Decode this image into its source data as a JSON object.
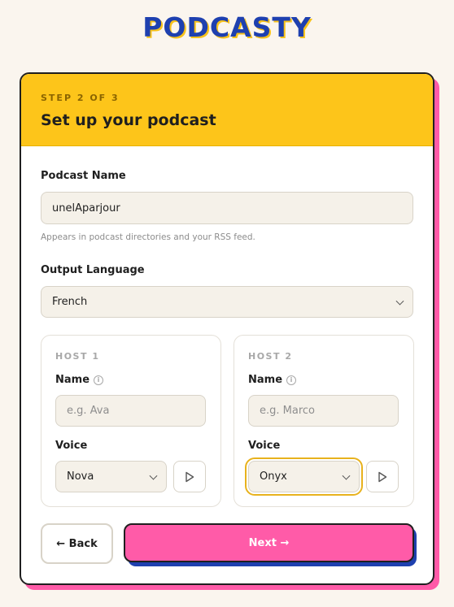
{
  "brand": {
    "logo": "PODCASTY"
  },
  "header": {
    "step": "STEP 2 OF 3",
    "title": "Set up your podcast"
  },
  "podcast_name": {
    "label": "Podcast Name",
    "value": "unelAparjour",
    "helper": "Appears in podcast directories and your RSS feed."
  },
  "language": {
    "label": "Output Language",
    "selected": "French"
  },
  "hosts": [
    {
      "title": "HOST 1",
      "name_label": "Name",
      "name_placeholder": "e.g. Ava",
      "voice_label": "Voice",
      "voice": "Nova"
    },
    {
      "title": "HOST 2",
      "name_label": "Name",
      "name_placeholder": "e.g. Marco",
      "voice_label": "Voice",
      "voice": "Onyx"
    }
  ],
  "actions": {
    "back": "← Back",
    "next": "Next →"
  },
  "colors": {
    "accent_yellow": "#fdc51a",
    "accent_pink": "#ff5ba8",
    "brand_blue": "#1e40af"
  }
}
